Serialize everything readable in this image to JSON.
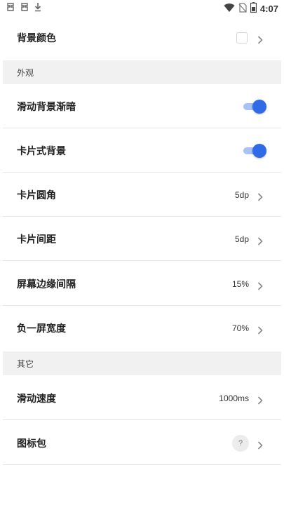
{
  "status_bar": {
    "time": "4:07",
    "left_icons": [
      "notification-app-icon",
      "notification-app-icon",
      "download-icon"
    ],
    "right_icons": [
      "wifi-icon",
      "no-sim-icon",
      "battery-icon"
    ]
  },
  "settings": {
    "background_color": {
      "label": "背景颜色",
      "swatch_color": "#ffffff"
    },
    "section_appearance": {
      "title": "外观"
    },
    "scroll_bg_fade": {
      "label": "滑动背景渐暗",
      "enabled": true
    },
    "card_background": {
      "label": "卡片式背景",
      "enabled": true
    },
    "card_corner": {
      "label": "卡片圆角",
      "value": "5dp"
    },
    "card_spacing": {
      "label": "卡片间距",
      "value": "5dp"
    },
    "screen_edge_spacing": {
      "label": "屏幕边缘间隔",
      "value": "15%"
    },
    "minus_one_width": {
      "label": "负一屏宽度",
      "value": "70%"
    },
    "section_other": {
      "title": "其它"
    },
    "scroll_speed": {
      "label": "滑动速度",
      "value": "1000ms"
    },
    "icon_pack": {
      "label": "图标包",
      "badge": "?"
    }
  },
  "colors": {
    "accent": "#2f6be6",
    "accent_track": "#a9c1f4",
    "section_bg": "#f1f1f1",
    "divider": "#e6e6e6"
  }
}
